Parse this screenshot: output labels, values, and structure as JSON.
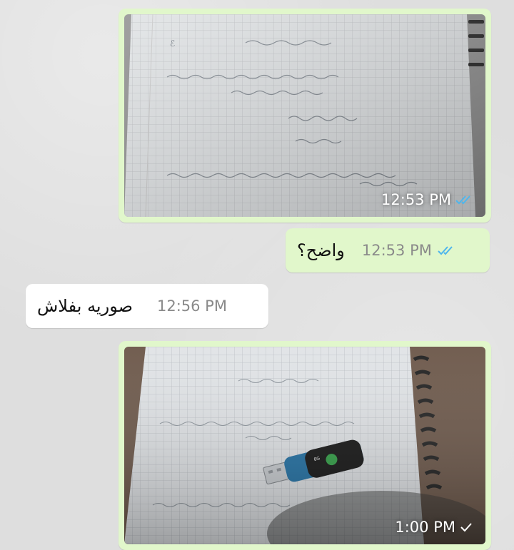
{
  "messages": [
    {
      "type": "image",
      "direction": "outgoing",
      "time": "12:53 PM",
      "status": "read",
      "content": "photo of grid notebook page with handwritten math"
    },
    {
      "type": "text",
      "direction": "outgoing",
      "text": "واضح؟",
      "time": "12:53 PM",
      "status": "read"
    },
    {
      "type": "text",
      "direction": "incoming",
      "text": "صوريه بفلاش",
      "time": "12:56 PM"
    },
    {
      "type": "image",
      "direction": "outgoing",
      "time": "1:00 PM",
      "status": "sent",
      "content": "photo of grid notebook page with a blue USB flash drive on it"
    }
  ],
  "colors": {
    "outgoing_bubble": "#e1f7cb",
    "incoming_bubble": "#ffffff",
    "read_tick": "#4fb6ec",
    "chat_background": "#dedede"
  }
}
